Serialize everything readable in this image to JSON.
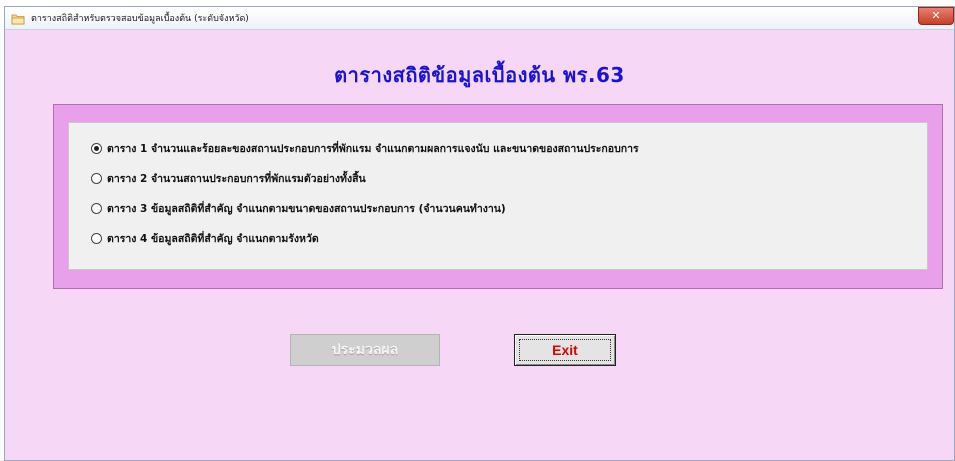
{
  "window": {
    "title": "ตารางสถิติสำหรับตรวจสอบข้อมูลเบื้องต้น (ระดับจังหวัด)",
    "close_label": "✕"
  },
  "heading": "ตารางสถิติข้อมูลเบื้องต้น   พร.63",
  "options": [
    {
      "label": "ตาราง 1 จำนวนและร้อยละของสถานประกอบการที่พักแรม  จำแนกตามผลการแจงนับ  และขนาดของสถานประกอบการ",
      "selected": true
    },
    {
      "label": "ตาราง 2 จำนวนสถานประกอบการที่พักแรมตัวอย่างทั้งสิ้น",
      "selected": false
    },
    {
      "label": "ตาราง 3  ข้อมูลสถิติที่สำคัญ จำแนกตามขนาดของสถานประกอบการ (จำนวนคนทำงาน)",
      "selected": false
    },
    {
      "label": "ตาราง 4  ข้อมูลสถิติที่สำคัญ จำแนกตามรังหวัด",
      "selected": false
    }
  ],
  "buttons": {
    "process_label": "ประมวลผล",
    "exit_label": "Exit"
  },
  "colors": {
    "background": "#f6d8f6",
    "frame": "#e8a0ea",
    "heading": "#1a12d6",
    "exit_text": "#e00000"
  }
}
